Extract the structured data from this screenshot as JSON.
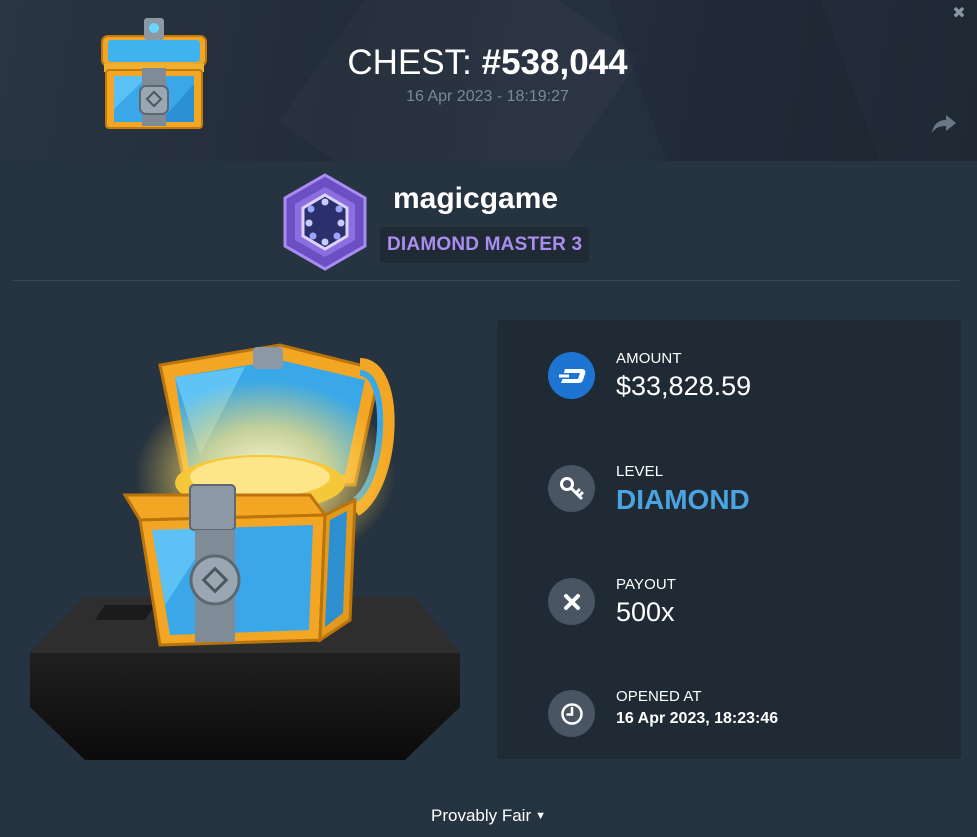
{
  "header": {
    "title_prefix": "CHEST:",
    "chest_number": "#538,044",
    "created_at": "16 Apr 2023 - 18:19:27"
  },
  "user": {
    "name": "magicgame",
    "rank": "DIAMOND MASTER 3"
  },
  "details": {
    "amount_label": "AMOUNT",
    "amount_value": "$33,828.59",
    "level_label": "LEVEL",
    "level_value": "DIAMOND",
    "payout_label": "PAYOUT",
    "payout_value": "500x",
    "opened_label": "OPENED AT",
    "opened_value": "16 Apr 2023, 18:23:46"
  },
  "footer": {
    "provably_fair": "Provably Fair"
  },
  "colors": {
    "background": "#263340",
    "panel": "#1f2a35",
    "rank_text": "#a98ef0",
    "level_text": "#4ba3e0",
    "dash_blue": "#1e74d2"
  },
  "icons": {
    "close": "close-icon",
    "share": "share-icon",
    "amount": "dash-coin-icon",
    "level": "key-icon",
    "payout": "multiply-icon",
    "opened": "clock-icon",
    "caret": "caret-down-icon"
  }
}
